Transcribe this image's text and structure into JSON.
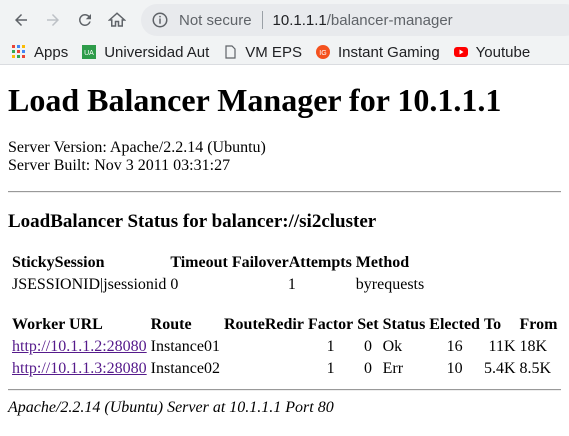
{
  "browser": {
    "security_label": "Not secure",
    "url_host": "10.1.1.1",
    "url_path": "/balancer-manager",
    "bookmarks": [
      {
        "label": "Apps",
        "icon": "apps-grid-icon"
      },
      {
        "label": "Universidad Aut",
        "icon": "ua-favicon"
      },
      {
        "label": "VM EPS",
        "icon": "page-icon"
      },
      {
        "label": "Instant Gaming",
        "icon": "instant-gaming-icon"
      },
      {
        "label": "Youtube",
        "icon": "youtube-icon"
      }
    ]
  },
  "page": {
    "title": "Load Balancer Manager for 10.1.1.1",
    "server_version": "Server Version: Apache/2.2.14 (Ubuntu)",
    "server_built": "Server Built: Nov 3 2011 03:31:27",
    "status_heading": "LoadBalancer Status for balancer://si2cluster",
    "status_table": {
      "headers": [
        "StickySession",
        "Timeout",
        "FailoverAttempts",
        "Method"
      ],
      "row": [
        "JSESSIONID|jsessionid",
        "0",
        "1",
        "byrequests"
      ]
    },
    "workers_table": {
      "headers": [
        "Worker URL",
        "Route",
        "RouteRedir",
        "Factor",
        "Set",
        "Status",
        "Elected",
        "To",
        "From"
      ],
      "rows": [
        [
          "http://10.1.1.2:28080",
          "Instance01",
          "",
          "1",
          "0",
          "Ok",
          "16",
          "11K",
          "18K"
        ],
        [
          "http://10.1.1.3:28080",
          "Instance02",
          "",
          "1",
          "0",
          "Err",
          "10",
          "5.4K",
          "8.5K"
        ]
      ]
    },
    "footer": "Apache/2.2.14 (Ubuntu) Server at 10.1.1.1 Port 80"
  }
}
